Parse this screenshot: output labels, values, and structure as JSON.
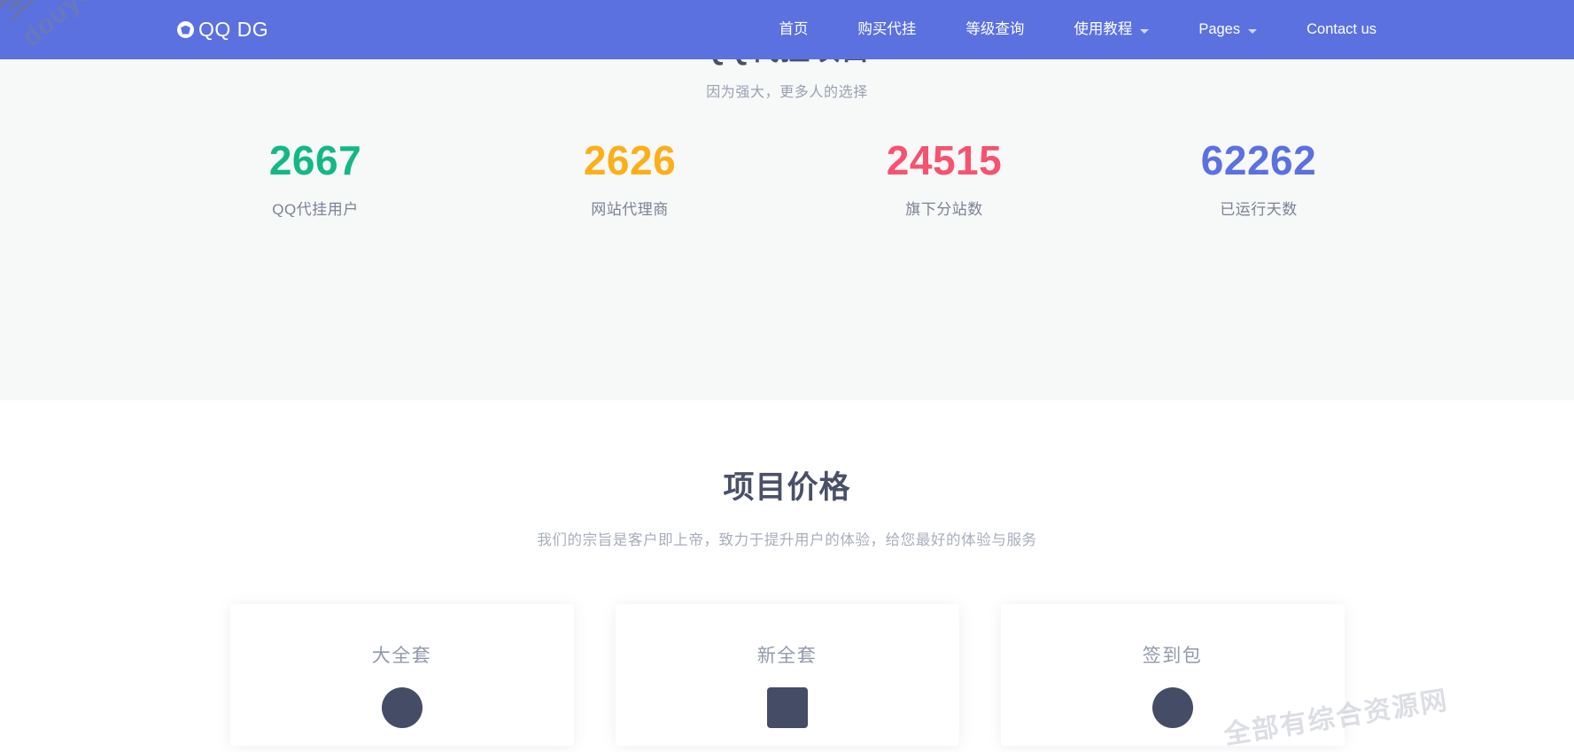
{
  "header": {
    "brand": {
      "mark_icon": "paper-plane-circle-icon",
      "text": "QQ DG"
    },
    "nav": [
      {
        "label": "首页",
        "has_caret": false
      },
      {
        "label": "购买代挂",
        "has_caret": false
      },
      {
        "label": "等级查询",
        "has_caret": false
      },
      {
        "label": "使用教程",
        "has_caret": true
      },
      {
        "label": "Pages",
        "has_caret": true
      },
      {
        "label": "Contact us",
        "has_caret": false
      }
    ],
    "bg_color": "#5b71e0"
  },
  "stats": {
    "title": "QQ代挂项目",
    "subtitle": "因为强大，更多人的选择",
    "items": [
      {
        "value": "2667",
        "label": "QQ代挂用户",
        "color": "#12b886"
      },
      {
        "value": "2626",
        "label": "网站代理商",
        "color": "#fcaf17"
      },
      {
        "value": "24515",
        "label": "旗下分站数",
        "color": "#f7526f"
      },
      {
        "value": "62262",
        "label": "已运行天数",
        "color": "#5b71e0"
      }
    ],
    "bg_color": "#f7f8f8"
  },
  "pricing": {
    "title": "项目价格",
    "subtitle": "我们的宗旨是客户即上帝，致力于提升用户的体验，给您最好的体验与服务",
    "cards": [
      {
        "title": "大全套",
        "icon": "circle-icon"
      },
      {
        "title": "新全套",
        "icon": "square-icon"
      },
      {
        "title": "签到包",
        "icon": "circle-icon"
      }
    ]
  },
  "watermarks": {
    "primary_cn": "全部有综合资源网",
    "primary_en": "douyouvip.com",
    "card_overlay": "全部有综合资源网"
  }
}
